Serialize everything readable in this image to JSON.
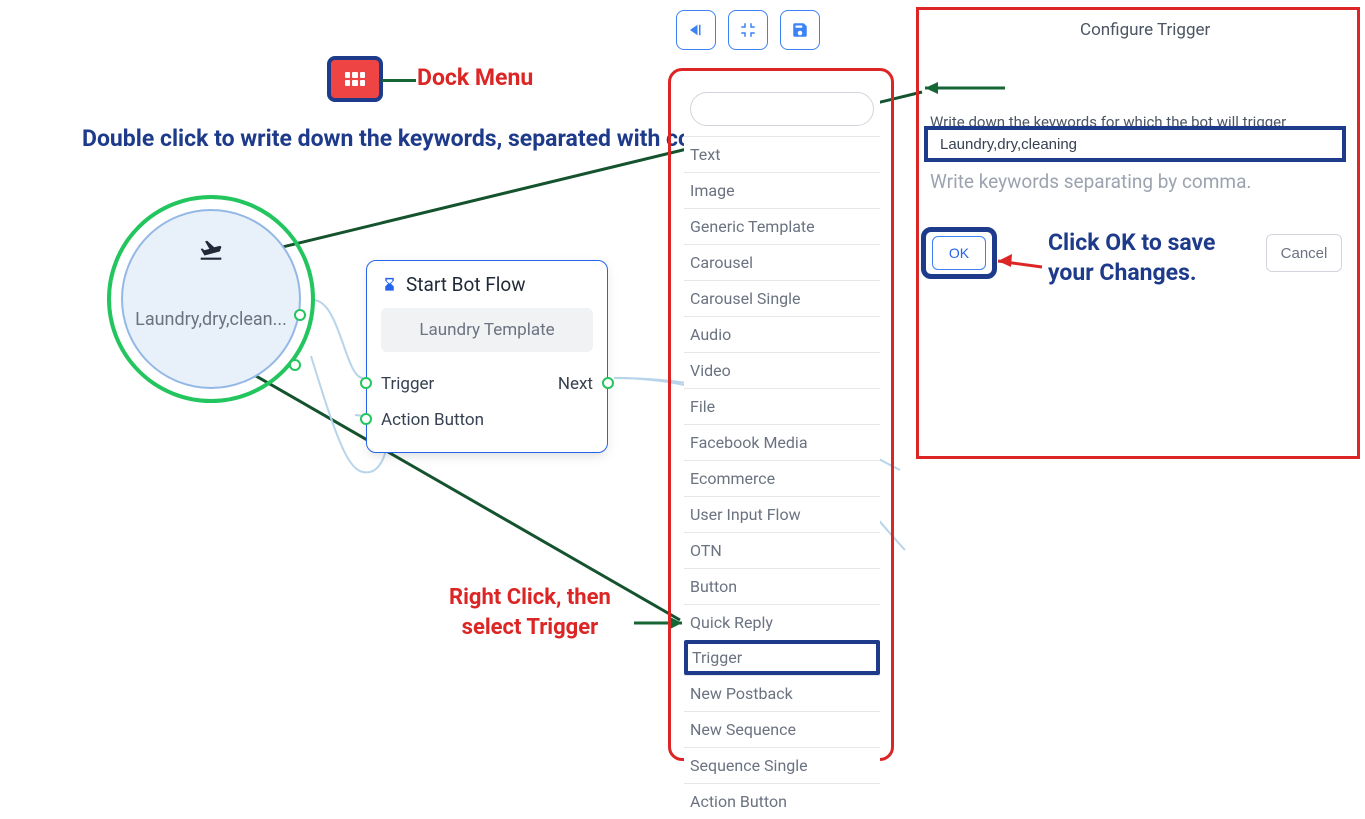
{
  "toolbar": {
    "back": "Back",
    "fit": "Fit",
    "save": "Save"
  },
  "dock": {
    "label": "Dock Menu"
  },
  "annotations": {
    "doubleclick": "Double click to write down the keywords, separated with comma",
    "rightclick_l1": "Right Click, then",
    "rightclick_l2": "select Trigger",
    "ok_l1": "Click OK to save",
    "ok_l2": "your Changes."
  },
  "trigger_node": {
    "text": "Laundry,dry,clean..."
  },
  "flow_card": {
    "title": "Start Bot Flow",
    "template": "Laundry Template",
    "row1_left": "Trigger",
    "row1_right": "Next",
    "row2": "Action Button"
  },
  "context_menu": {
    "items": [
      "Text",
      "Image",
      "Generic Template",
      "Carousel",
      "Carousel Single",
      "Audio",
      "Video",
      "File",
      "Facebook Media",
      "Ecommerce",
      "User Input Flow",
      "OTN",
      "Button",
      "Quick Reply",
      "Trigger",
      "New Postback",
      "New Sequence",
      "Sequence Single",
      "Action Button"
    ],
    "highlight_index": 14
  },
  "panel": {
    "title": "Configure Trigger",
    "prompt": "Write down the keywords for which the bot will trigger",
    "value": "Laundry,dry,cleaning",
    "hint": "Write keywords separating by comma.",
    "ok": "OK",
    "cancel": "Cancel"
  }
}
